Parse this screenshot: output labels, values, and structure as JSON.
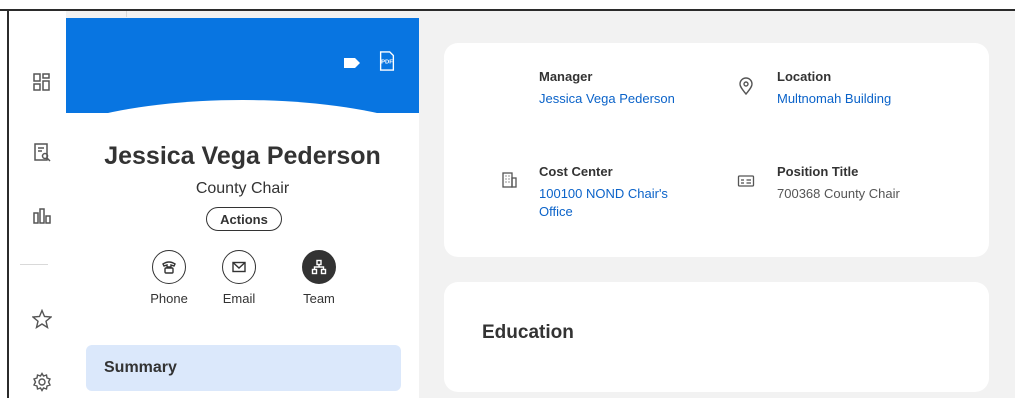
{
  "profile": {
    "name": "Jessica Vega Pederson",
    "title": "County Chair",
    "actions_label": "Actions",
    "quick_actions": [
      {
        "label": "Phone",
        "icon": "phone-icon"
      },
      {
        "label": "Email",
        "icon": "email-icon"
      },
      {
        "label": "Team",
        "icon": "team-icon"
      }
    ],
    "header_icons": [
      "tag-icon",
      "pdf-icon"
    ],
    "pdf_text": "PDF",
    "summary_tab": "Summary"
  },
  "rail": {
    "icons": [
      "dashboard-icon",
      "report-icon",
      "chart-icon",
      "star-icon",
      "gear-icon"
    ]
  },
  "details": {
    "manager": {
      "label": "Manager",
      "value": "Jessica Vega Pederson"
    },
    "location": {
      "label": "Location",
      "value": "Multnomah Building"
    },
    "cost_center": {
      "label": "Cost Center",
      "value_line1": "100100 NOND Chair's",
      "value_line2": "Office"
    },
    "position_title": {
      "label": "Position Title",
      "value": "700368 County Chair"
    }
  },
  "education": {
    "heading": "Education"
  },
  "colors": {
    "header_blue": "#0875e1",
    "link_blue": "#0b63c9",
    "summary_bg": "#dbe8fb",
    "page_bg": "#f2f2f2"
  }
}
